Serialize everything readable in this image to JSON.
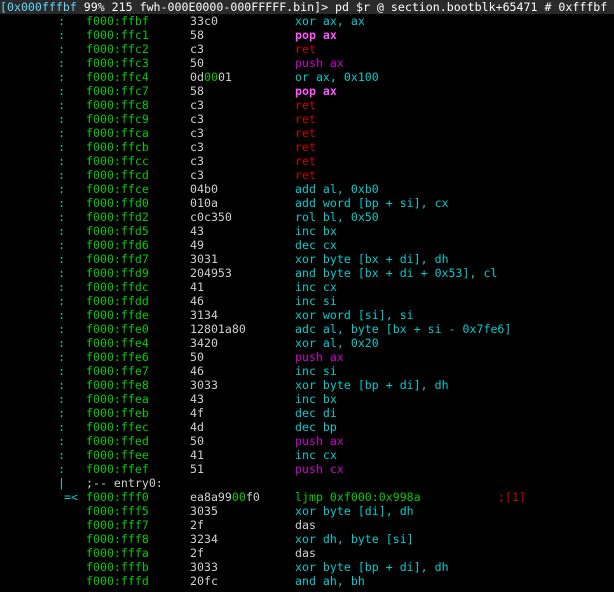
{
  "prompt": {
    "address": "[0x000fffbf",
    "rest": " 99% 215 fwh-000E0000-000FFFFF.bin]> pd $r @ section.bootblk+65471 # 0xfffbf"
  },
  "rows": [
    {
      "g": ":",
      "addr": "f000:ffbf",
      "bytes": "33c0",
      "op": "xor ax, ax",
      "kind": "normal"
    },
    {
      "g": ":",
      "addr": "f000:ffc1",
      "bytes": "58",
      "op": "pop ax",
      "kind": "bold"
    },
    {
      "g": ":",
      "addr": "f000:ffc2",
      "bytes": "c3",
      "op": "ret",
      "kind": "ret"
    },
    {
      "g": ":",
      "addr": "f000:ffc3",
      "bytes": "50",
      "op": "push ax",
      "kind": "stack"
    },
    {
      "g": ":",
      "addr": "f000:ffc4",
      "bytes_parts": [
        "0d",
        "00",
        "01"
      ],
      "op": "or ax, 0x100",
      "kind": "normal"
    },
    {
      "g": ":",
      "addr": "f000:ffc7",
      "bytes": "58",
      "op": "pop ax",
      "kind": "bold"
    },
    {
      "g": ":",
      "addr": "f000:ffc8",
      "bytes": "c3",
      "op": "ret",
      "kind": "ret"
    },
    {
      "g": ":",
      "addr": "f000:ffc9",
      "bytes": "c3",
      "op": "ret",
      "kind": "ret"
    },
    {
      "g": ":",
      "addr": "f000:ffca",
      "bytes": "c3",
      "op": "ret",
      "kind": "ret"
    },
    {
      "g": ":",
      "addr": "f000:ffcb",
      "bytes": "c3",
      "op": "ret",
      "kind": "ret"
    },
    {
      "g": ":",
      "addr": "f000:ffcc",
      "bytes": "c3",
      "op": "ret",
      "kind": "ret"
    },
    {
      "g": ":",
      "addr": "f000:ffcd",
      "bytes": "c3",
      "op": "ret",
      "kind": "ret"
    },
    {
      "g": ":",
      "addr": "f000:ffce",
      "bytes": "04b0",
      "op": "add al, 0xb0",
      "kind": "normal"
    },
    {
      "g": ":",
      "addr": "f000:ffd0",
      "bytes": "010a",
      "op": "add word [bp + si], cx",
      "kind": "normal"
    },
    {
      "g": ":",
      "addr": "f000:ffd2",
      "bytes": "c0c350",
      "op": "rol bl, 0x50",
      "kind": "normal"
    },
    {
      "g": ":",
      "addr": "f000:ffd5",
      "bytes": "43",
      "op": "inc bx",
      "kind": "normal"
    },
    {
      "g": ":",
      "addr": "f000:ffd6",
      "bytes": "49",
      "op": "dec cx",
      "kind": "normal"
    },
    {
      "g": ":",
      "addr": "f000:ffd7",
      "bytes": "3031",
      "op": "xor byte [bx + di], dh",
      "kind": "normal"
    },
    {
      "g": ":",
      "addr": "f000:ffd9",
      "bytes": "204953",
      "op": "and byte [bx + di + 0x53], cl",
      "kind": "normal"
    },
    {
      "g": ":",
      "addr": "f000:ffdc",
      "bytes": "41",
      "op": "inc cx",
      "kind": "normal"
    },
    {
      "g": ":",
      "addr": "f000:ffdd",
      "bytes": "46",
      "op": "inc si",
      "kind": "normal"
    },
    {
      "g": ":",
      "addr": "f000:ffde",
      "bytes": "3134",
      "op": "xor word [si], si",
      "kind": "normal"
    },
    {
      "g": ":",
      "addr": "f000:ffe0",
      "bytes": "12801a80",
      "op": "adc al, byte [bx + si - 0x7fe6]",
      "kind": "normal"
    },
    {
      "g": ":",
      "addr": "f000:ffe4",
      "bytes": "3420",
      "op": "xor al, 0x20",
      "kind": "normal"
    },
    {
      "g": ":",
      "addr": "f000:ffe6",
      "bytes": "50",
      "op": "push ax",
      "kind": "stack"
    },
    {
      "g": ":",
      "addr": "f000:ffe7",
      "bytes": "46",
      "op": "inc si",
      "kind": "normal"
    },
    {
      "g": ":",
      "addr": "f000:ffe8",
      "bytes": "3033",
      "op": "xor byte [bp + di], dh",
      "kind": "normal"
    },
    {
      "g": ":",
      "addr": "f000:ffea",
      "bytes": "43",
      "op": "inc bx",
      "kind": "normal"
    },
    {
      "g": ":",
      "addr": "f000:ffeb",
      "bytes": "4f",
      "op": "dec di",
      "kind": "normal"
    },
    {
      "g": ":",
      "addr": "f000:ffec",
      "bytes": "4d",
      "op": "dec bp",
      "kind": "normal"
    },
    {
      "g": ":",
      "addr": "f000:ffed",
      "bytes": "50",
      "op": "push ax",
      "kind": "stack"
    },
    {
      "g": ":",
      "addr": "f000:ffee",
      "bytes": "41",
      "op": "inc cx",
      "kind": "normal"
    },
    {
      "g": ":",
      "addr": "f000:ffef",
      "bytes": "51",
      "op": "push cx",
      "kind": "stack"
    },
    {
      "g": "|",
      "flag": ";-- entry0:",
      "kind": "flag"
    },
    {
      "g": "=<",
      "addr": "f000:fff0",
      "bytes_parts": [
        "ea8a99",
        "00",
        "f0"
      ],
      "op": "ljmp 0xf000:0x998a",
      "kind": "jmp",
      "comment": ";[1]"
    },
    {
      "g": "",
      "addr": "f000:fff5",
      "bytes": "3035",
      "op": "xor byte [di], dh",
      "kind": "normal"
    },
    {
      "g": "",
      "addr": "f000:fff7",
      "bytes": "2f",
      "op": "das",
      "kind": "plain"
    },
    {
      "g": "",
      "addr": "f000:fff8",
      "bytes": "3234",
      "op": "xor dh, byte [si]",
      "kind": "normal"
    },
    {
      "g": "",
      "addr": "f000:fffa",
      "bytes": "2f",
      "op": "das",
      "kind": "plain"
    },
    {
      "g": "",
      "addr": "f000:fffb",
      "bytes": "3033",
      "op": "xor byte [bp + di], dh",
      "kind": "normal"
    },
    {
      "g": "",
      "addr": "f000:fffd",
      "bytes": "20fc",
      "op": "and ah, bh",
      "kind": "normal"
    }
  ]
}
